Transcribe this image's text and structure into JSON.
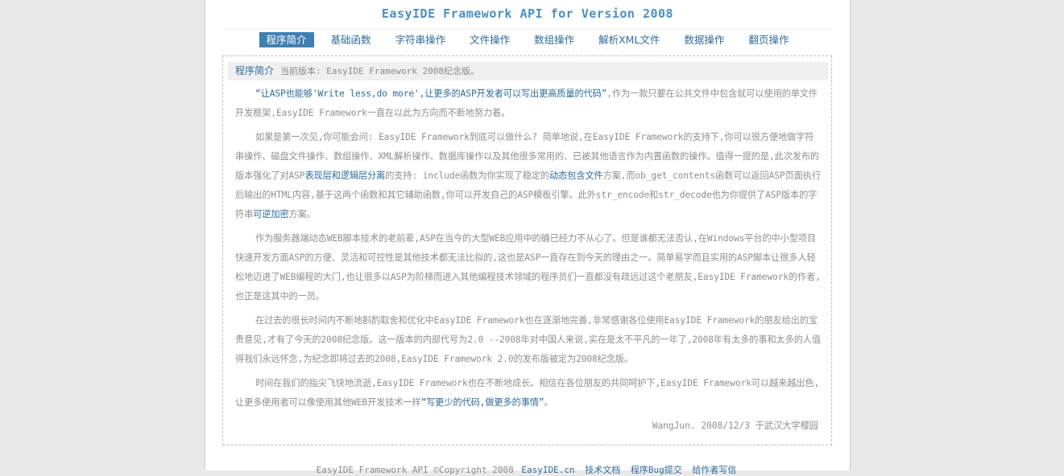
{
  "header": {
    "title": "EasyIDE Framework API for Version 2008"
  },
  "nav": {
    "items": [
      {
        "label": "程序简介",
        "active": true
      },
      {
        "label": "基础函数"
      },
      {
        "label": "字符串操作"
      },
      {
        "label": "文件操作"
      },
      {
        "label": "数组操作"
      },
      {
        "label": "解析XML文件"
      },
      {
        "label": "数据操作"
      },
      {
        "label": "翻页操作"
      }
    ]
  },
  "crumb": {
    "section": "程序简介",
    "text": "当前版本: EasyIDE Framework 2008纪念版。"
  },
  "paragraphs": {
    "p1": {
      "quote": "“让ASP也能够'Write less,do more',让更多的ASP开发者可以写出更高质量的代码”",
      "rest": ",作为一款只要在公共文件中包含就可以使用的单文件开发框架,EasyIDE Framework一直在以此为方向而不断地努力着。"
    },
    "p2": {
      "a": "如果是第一次见,你可能会问: EasyIDE Framework到底可以做什么? 简单地说,在EasyIDE Framework的支持下,你可以很方便地做字符串操作、磁盘文件操作、数组操作、XML解析操作、数据库操作以及其他很多常用的、已被其他语言作为内置函数的操作。值得一提的是,此次发布的版本强化了对ASP",
      "hl1": "表现层和逻辑层分离",
      "b": "的支持: include函数为你实现了稳定的",
      "hl2": "动态包含文件",
      "c": "方案,而ob_get_contents函数可以返回ASP页面执行后输出的HTML内容,基于这两个函数和其它辅助函数,你可以开发自己的ASP模板引擎。此外str_encode和str_decode也为你提供了ASP版本的字符串",
      "hl3": "可逆加密",
      "d": "方案。"
    },
    "p3": "作为服务器端动态WEB脚本技术的老前辈,ASP在当今的大型WEB应用中的确已经力不从心了。但是谁都无法否认,在Windows平台的中小型项目快速开发方面ASP的方便、灵活和可控性是其他技术都无法比拟的,这也是ASP一直存在到今天的理由之一。简单易学而且实用的ASP脚本让很多人轻松地迈进了WEB编程的大门,也让很多以ASP为阶梯而进入其他编程技术领域的程序员们一直都没有疏远过这个老朋友,EasyIDE Framework的作者,也正是这其中的一员。",
    "p4": "在过去的很长时间内不断地斟酌取舍和优化中EasyIDE Framework也在逐渐地完善,非常感谢各位使用EasyIDE Framework的朋友给出的宝贵意见,才有了今天的2008纪念版。这一版本的内部代号为2.0 --2008年对中国人来说,实在是太不平凡的一年了,2008年有太多的事和太多的人值得我们永远怀念,为纪念即将过去的2008,EasyIDE Framework 2.0的发布版被定为2008纪念版。",
    "p5": {
      "a": "时间在我们的指尖飞快地流逝,EasyIDE Framework也在不断地成长。相信在各位朋友的共同呵护下,EasyIDE Framework可以越来越出色,让更多使用者可以像使用其他WEB开发技术一样",
      "hl": "“写更少的代码,做更多的事情”",
      "b": "。"
    }
  },
  "signature": "WangJun. 2008/12/3 于武汉大学樱园",
  "footer": {
    "text": "EasyIDE Framework API ©Copyright 2008",
    "links": [
      "EasyIDE.cn",
      "技术文档",
      "程序Bug提交",
      "给作者写信"
    ]
  },
  "colors": {
    "accent": "#3f7fb3",
    "link": "#2e6a9e",
    "title": "#4a8fc4"
  }
}
